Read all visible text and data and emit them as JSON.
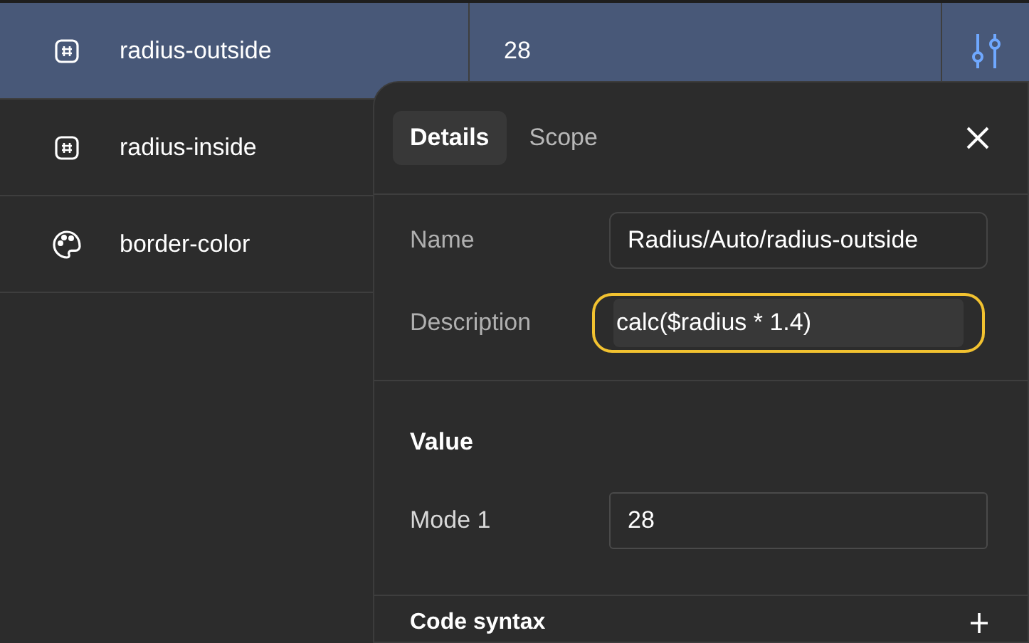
{
  "variables": [
    {
      "kind": "number",
      "name": "radius-outside",
      "value": "28",
      "selected": true
    },
    {
      "kind": "number",
      "name": "radius-inside",
      "selected": false
    },
    {
      "kind": "color",
      "name": "border-color",
      "selected": false
    }
  ],
  "popup": {
    "tabs": [
      {
        "label": "Details",
        "selected": true
      },
      {
        "label": "Scope",
        "selected": false
      }
    ],
    "name": {
      "label": "Name",
      "value": "Radius/Auto/radius-outside"
    },
    "description": {
      "label": "Description",
      "value": "calc($radius * 1.4)",
      "focused": true
    },
    "value_section": {
      "title": "Value",
      "modes": [
        {
          "label": "Mode 1",
          "value": "28"
        }
      ]
    },
    "code_syntax": {
      "title": "Code syntax"
    }
  }
}
